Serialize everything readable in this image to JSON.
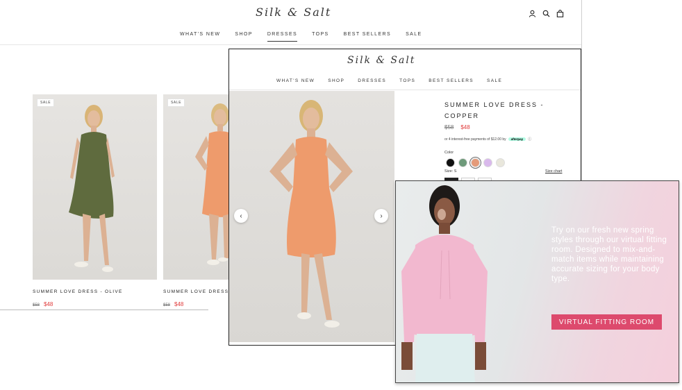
{
  "brand": {
    "logo": "Silk & Salt"
  },
  "nav": {
    "items": [
      {
        "label": "WHAT'S NEW"
      },
      {
        "label": "SHOP"
      },
      {
        "label": "DRESSES"
      },
      {
        "label": "TOPS"
      },
      {
        "label": "BEST SELLERS"
      },
      {
        "label": "SALE"
      }
    ],
    "active": "DRESSES"
  },
  "header_icons": [
    "account-icon",
    "search-icon",
    "cart-icon"
  ],
  "category": {
    "products": [
      {
        "badge": "SALE",
        "name": "SUMMER LOVE DRESS - OLIVE",
        "original_price": "$58",
        "sale_price": "$48",
        "dress_color": "#5f6b3e"
      },
      {
        "badge": "SALE",
        "name": "SUMMER LOVE DRESS - C",
        "original_price": "$58",
        "sale_price": "$48",
        "dress_color": "#ee9b6c"
      }
    ]
  },
  "product": {
    "title": "SUMMER LOVE DRESS - COPPER",
    "original_price": "$58",
    "sale_price": "$48",
    "installment_text": "or 4 interest-free payments of $12.00 by",
    "afterpay_label": "afterpay",
    "info_icon": "ⓘ",
    "color_label": "Color",
    "swatches": [
      {
        "name": "black",
        "hex": "#111111",
        "selected": false
      },
      {
        "name": "sage",
        "hex": "#6e9a7a",
        "selected": false
      },
      {
        "name": "copper",
        "hex": "#e59b7a",
        "selected": true
      },
      {
        "name": "lilac",
        "hex": "#d9b9ec",
        "selected": false
      },
      {
        "name": "cream",
        "hex": "#e9e7dc",
        "selected": false
      }
    ],
    "size_label": "Size: S",
    "size_chart_label": "Size chart",
    "dress_color": "#ee9b6c",
    "prev_arrow": "‹",
    "next_arrow": "›"
  },
  "promo": {
    "text": "Try on our fresh new spring styles through our virtual fitting room. Designed to mix-and-match items while maintaining accurate sizing for your body type.",
    "button_label": "VIRTUAL FITTING ROOM",
    "button_color": "#dd4a6d",
    "hoodie_color": "#f2b8cf"
  }
}
